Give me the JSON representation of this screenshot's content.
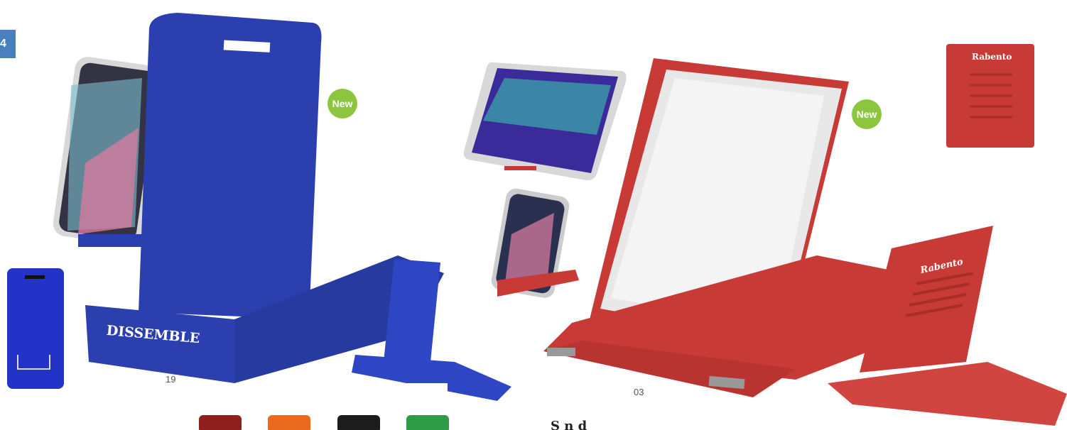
{
  "page_tab": "4",
  "products": [
    {
      "code": "19",
      "badge": "New",
      "print_text": "DISSEMBLE",
      "color": "#2b3fae"
    },
    {
      "code": "03",
      "badge": "New",
      "print_text": "Rabento",
      "color": "#c73a35"
    }
  ],
  "swatches": [
    "#8e1f1f",
    "#e96a1f",
    "#1c1c1c",
    "#2f9a47"
  ],
  "icons": [
    "phone-icon",
    "tablet-icon"
  ]
}
